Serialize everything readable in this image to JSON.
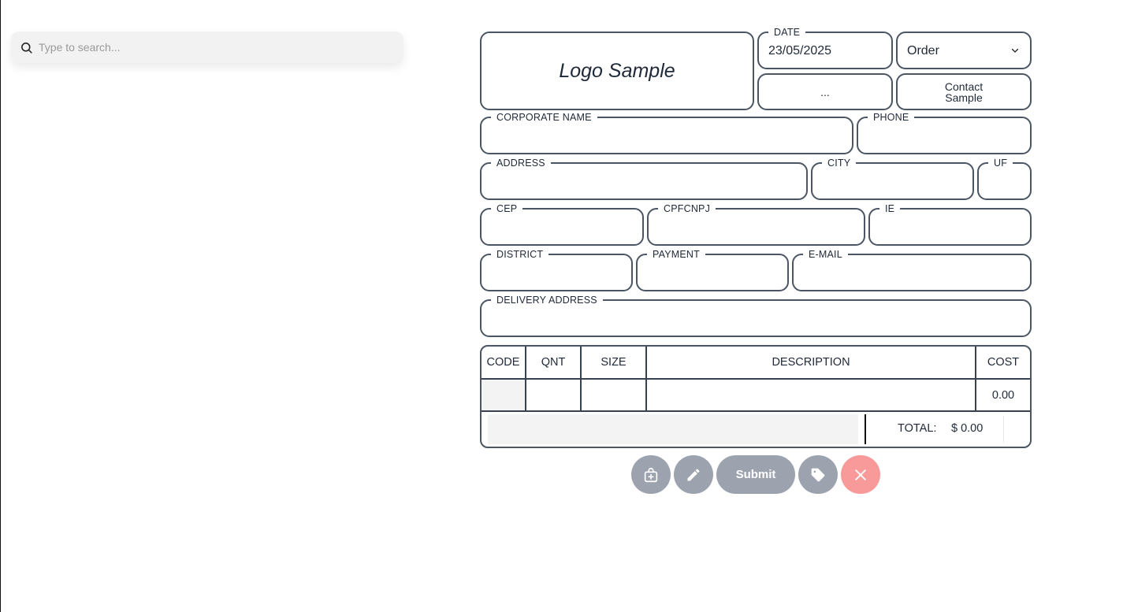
{
  "search": {
    "placeholder": "Type to search..."
  },
  "header": {
    "logo_text": "Logo Sample",
    "date_label": "DATE",
    "date_value": "23/05/2025",
    "order_type": "Order",
    "ellipsis_button": "...",
    "contact_button": "Contact Sample"
  },
  "fields": {
    "corporate_name": "CORPORATE NAME",
    "phone": "PHONE",
    "address": "ADDRESS",
    "city": "CITY",
    "uf": "UF",
    "cep": "CEP",
    "cpfcnpj": "CPFCNPJ",
    "ie": "IE",
    "district": "DISTRICT",
    "payment": "PAYMENT",
    "email": "E-MAIL",
    "delivery_address": "DELIVERY ADDRESS"
  },
  "table": {
    "headers": [
      "CODE",
      "QNT",
      "SIZE",
      "DESCRIPTION",
      "COST"
    ],
    "rows": [
      {
        "code": "",
        "qnt": "",
        "size": "",
        "description": "",
        "cost": "0.00"
      }
    ],
    "total_label": "TOTAL:",
    "total_value": "$ 0.00"
  },
  "actions": {
    "submit_label": "Submit"
  },
  "colors": {
    "border": "#4b5563",
    "button_gray": "#9ca3af",
    "button_close": "#f99a9a",
    "search_bg": "#f2f2f2"
  },
  "icons": [
    "search-icon",
    "chevron-down-icon",
    "add-bag-icon",
    "pencil-icon",
    "tag-icon",
    "close-icon"
  ]
}
